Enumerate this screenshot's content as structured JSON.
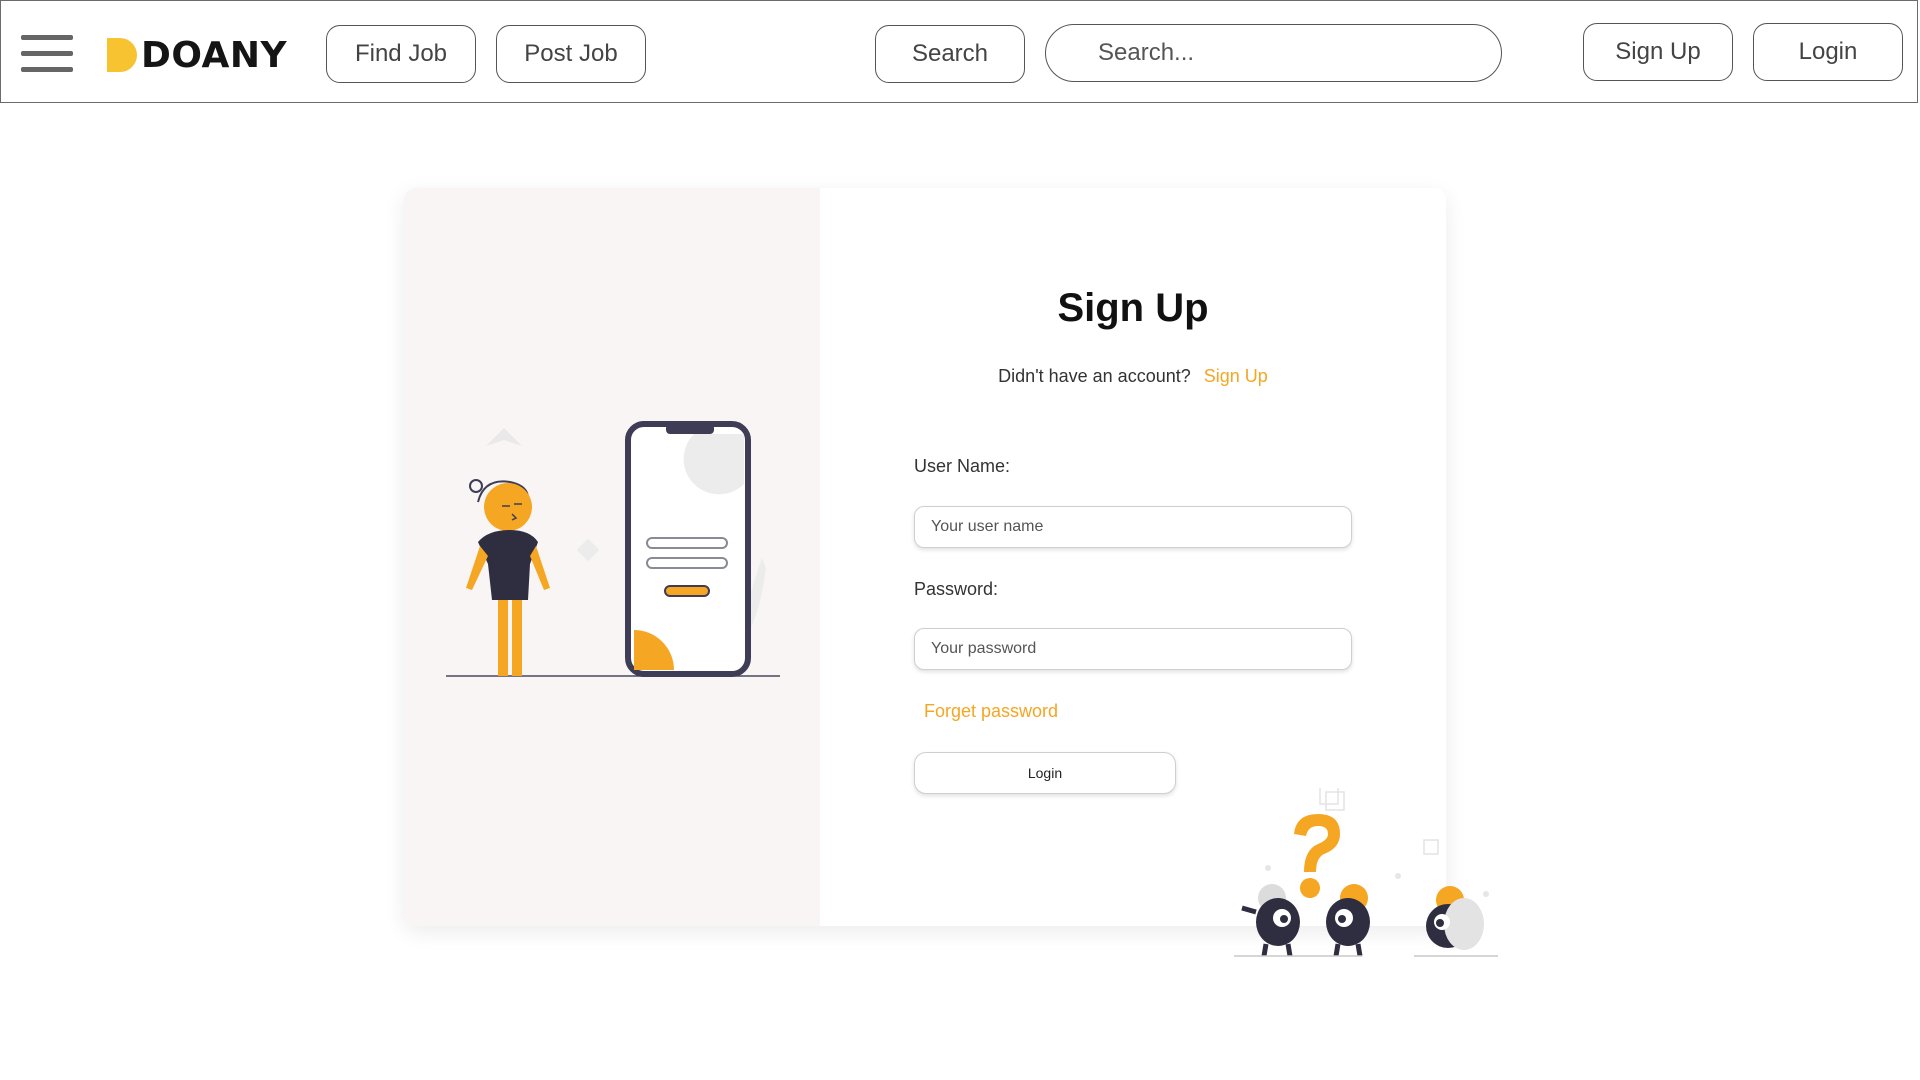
{
  "header": {
    "logo_text": "DOANY",
    "find_job": "Find Job",
    "post_job": "Post Job",
    "search_button": "Search",
    "search_placeholder": "Search...",
    "sign_up": "Sign Up",
    "login": "Login"
  },
  "form": {
    "title": "Sign Up",
    "prompt": "Didn't have an account?",
    "prompt_link": "Sign Up",
    "username_label": "User Name:",
    "username_placeholder": "Your user name",
    "password_label": "Password:",
    "password_placeholder": "Your password",
    "forget_password": "Forget password",
    "login_button": "Login"
  },
  "colors": {
    "accent": "#f5a623",
    "logo_yellow": "#f7c331",
    "illustration_dark": "#2f2e41"
  }
}
